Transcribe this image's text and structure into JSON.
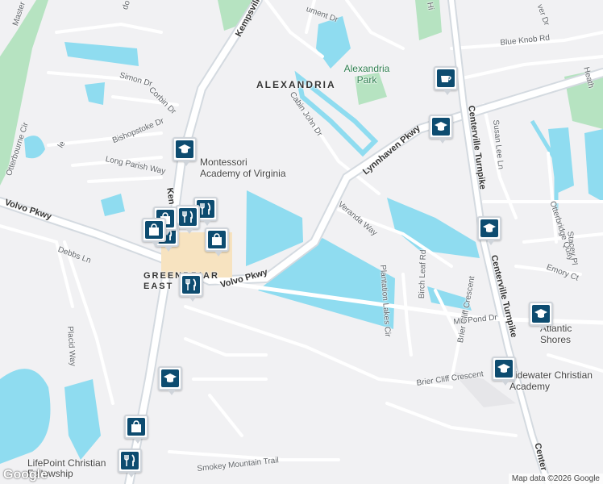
{
  "map": {
    "area_label": "ALEXANDRIA",
    "park_label": "Alexandria Park",
    "greenbriar": "GREENBRIAR EAST",
    "roads": {
      "kempsville": "Kempsville Rd",
      "volvo_left": "Volvo Pkwy",
      "volvo_center": "Volvo Pkwy",
      "lynnhaven": "Lynnhaven Pkwy",
      "centerville_top": "Centerville Turnpike",
      "centerville_mid": "Centerville Turnpike",
      "centerville_bottom": "Center",
      "master": "Master",
      "simon": "Simon Dr",
      "corbin": "Corbin Dr",
      "bishopstoke": "Bishopstoke Dr",
      "long_parish": "Long Parish Way",
      "otterbourne": "Otterbourne Cir",
      "debbs": "Debbs Ln",
      "placid": "Placid Way",
      "veranda": "Veranda Way",
      "plantation": "Plantation Lakes Cir",
      "birch_leaf": "Birch Leaf Rd",
      "mill_pond": "Mill Pond Dr",
      "brier_cliff": "Brier Cliff Crescent",
      "smokey": "Smokey Mountain Trail",
      "cabin_john": "Cabin John Dr",
      "blue_knob": "Blue Knob Rd",
      "susan_lee": "Susan Lee Ln",
      "otterbridge": "Otterbridge Quay",
      "stacey": "Stacey Pl",
      "emory": "Emory Ct",
      "monument": "ument Dr",
      "ver": "ver Dr",
      "heath": "Heath",
      "hi": "Hi",
      "do": "do",
      "le": "le",
      "ken": "Ken"
    },
    "pois": {
      "montessori": "Montessori Academy of Virginia",
      "atlantic": "Atlantic Shores Christian School",
      "tidewater": "Tidewater Christian Academy",
      "lifepoint": "LifePoint Christian Fellowship"
    },
    "footer": "Map data ©2026 Google",
    "google_logo": "Google"
  },
  "markers": [
    {
      "name": "cafe-marker",
      "icon": "coffee-icon",
      "label": "Cafe"
    },
    {
      "name": "school-marker-lynnhaven",
      "icon": "school-icon",
      "label": "School"
    },
    {
      "name": "school-marker-montessori",
      "icon": "school-icon",
      "label": "School"
    },
    {
      "name": "school-marker-centerville",
      "icon": "school-icon",
      "label": "School"
    },
    {
      "name": "school-marker-atlantic",
      "icon": "school-icon",
      "label": "School"
    },
    {
      "name": "school-marker-tidewater",
      "icon": "school-icon",
      "label": "School"
    },
    {
      "name": "school-marker-south",
      "icon": "school-icon",
      "label": "School"
    },
    {
      "name": "restaurant-marker-1",
      "icon": "restaurant-icon",
      "label": "Restaurant"
    },
    {
      "name": "restaurant-marker-2",
      "icon": "restaurant-icon",
      "label": "Restaurant"
    },
    {
      "name": "restaurant-marker-3",
      "icon": "restaurant-icon",
      "label": "Restaurant"
    },
    {
      "name": "restaurant-marker-4",
      "icon": "restaurant-icon",
      "label": "Restaurant"
    },
    {
      "name": "restaurant-marker-5",
      "icon": "restaurant-icon",
      "label": "Restaurant"
    },
    {
      "name": "shopping-marker-1",
      "icon": "shopping-bag-icon",
      "label": "Shopping"
    },
    {
      "name": "shopping-marker-2",
      "icon": "shopping-bag-icon",
      "label": "Shopping"
    },
    {
      "name": "shopping-marker-3",
      "icon": "shopping-bag-icon",
      "label": "Shopping"
    },
    {
      "name": "shopping-marker-4",
      "icon": "shopping-bag-icon",
      "label": "Shopping"
    }
  ],
  "colors": {
    "land": "#f1f1f3",
    "water": "#8fdcf0",
    "park": "#b6e3c1",
    "road": "#ffffff",
    "major_road": "#d4dae0",
    "marker": "#0d4c70"
  }
}
